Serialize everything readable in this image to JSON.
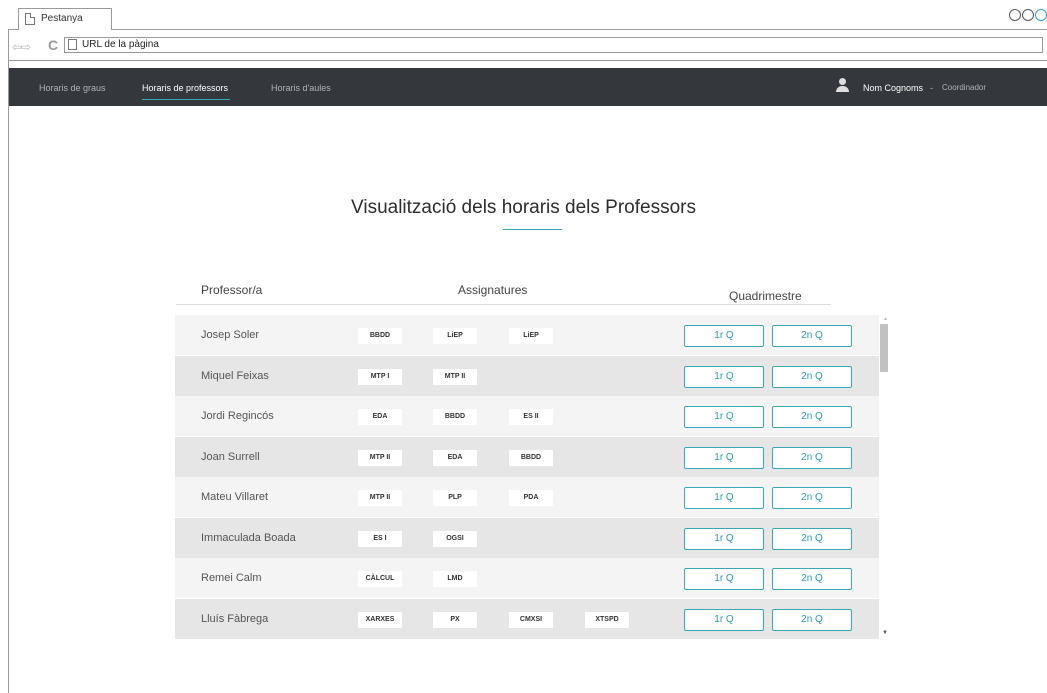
{
  "browser": {
    "tab_title": "Pestanya",
    "url": "URL de la pàgina",
    "nav_arrows": "⇦⇨",
    "reload_icon": "C"
  },
  "navbar": {
    "links": [
      "Horaris de graus",
      "Horaris de professors",
      "Horaris d'aules"
    ],
    "active_index": 1,
    "user_name": "Nom Cognoms",
    "separator": "-",
    "role": "Coordinador"
  },
  "main": {
    "title": "Visualització dels horaris dels Professors",
    "headers": {
      "professor": "Professor/a",
      "subjects": "Assignatures",
      "semester": "Quadrimestre"
    },
    "rows": [
      {
        "name": "Josep Soler",
        "subjects": [
          "BBDD",
          "LiEP",
          "LiEP"
        ],
        "q1": "1r Q",
        "q2": "2n Q"
      },
      {
        "name": "Miquel Feixas",
        "subjects": [
          "MTP I",
          "MTP II"
        ],
        "q1": "1r Q",
        "q2": "2n Q"
      },
      {
        "name": "Jordi Regincós",
        "subjects": [
          "EDA",
          "BBDD",
          "ES II"
        ],
        "q1": "1r Q",
        "q2": "2n Q"
      },
      {
        "name": "Joan Surrell",
        "subjects": [
          "MTP II",
          "EDA",
          "BBDD"
        ],
        "q1": "1r Q",
        "q2": "2n Q"
      },
      {
        "name": "Mateu Villaret",
        "subjects": [
          "MTP II",
          "PLP",
          "PDA"
        ],
        "q1": "1r Q",
        "q2": "2n Q"
      },
      {
        "name": "Immaculada Boada",
        "subjects": [
          "ES I",
          "OGSI"
        ],
        "q1": "1r Q",
        "q2": "2n Q"
      },
      {
        "name": "Remei Calm",
        "subjects": [
          "CÀLCUL",
          "LMD"
        ],
        "q1": "1r Q",
        "q2": "2n Q"
      },
      {
        "name": "Lluís Fàbrega",
        "subjects": [
          "XARXES",
          "PX",
          "CMXSI",
          "XTSPD"
        ],
        "q1": "1r Q",
        "q2": "2n Q"
      }
    ]
  },
  "colors": {
    "navbar_bg": "#34383c",
    "accent": "#3aa8b5",
    "row_light": "#f4f4f4",
    "row_dark": "#e6e6e6"
  },
  "icons": {
    "user": "user-icon",
    "page": "page-icon",
    "window_controls": "window-control-icons",
    "scroll_up": "▲",
    "scroll_down": "▼"
  }
}
